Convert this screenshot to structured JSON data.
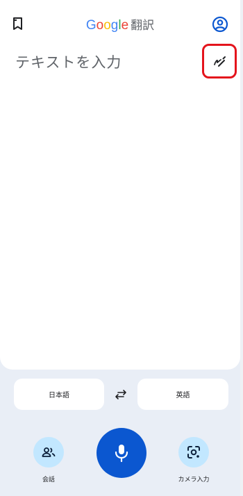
{
  "header": {
    "brand_letters": [
      {
        "char": "G",
        "color": "#4285F4"
      },
      {
        "char": "o",
        "color": "#EA4335"
      },
      {
        "char": "o",
        "color": "#FBBC05"
      },
      {
        "char": "g",
        "color": "#4285F4"
      },
      {
        "char": "l",
        "color": "#34A853"
      },
      {
        "char": "e",
        "color": "#EA4335"
      }
    ],
    "brand_suffix": "翻訳",
    "bookmark_icon": "bookmark-icon",
    "account_icon": "account-circle-icon"
  },
  "input": {
    "placeholder": "テキストを入力",
    "handwriting_icon": "handwriting-icon"
  },
  "languages": {
    "source": "日本語",
    "target": "英語",
    "swap_icon": "swap-icon"
  },
  "actions": {
    "conversation_label": "会話",
    "camera_label": "カメラ入力",
    "mic_icon": "mic-icon"
  },
  "colors": {
    "accent": "#0b57d0",
    "chip": "#c2e7ff",
    "background": "#e9eef6",
    "highlight": "#e4141c"
  }
}
